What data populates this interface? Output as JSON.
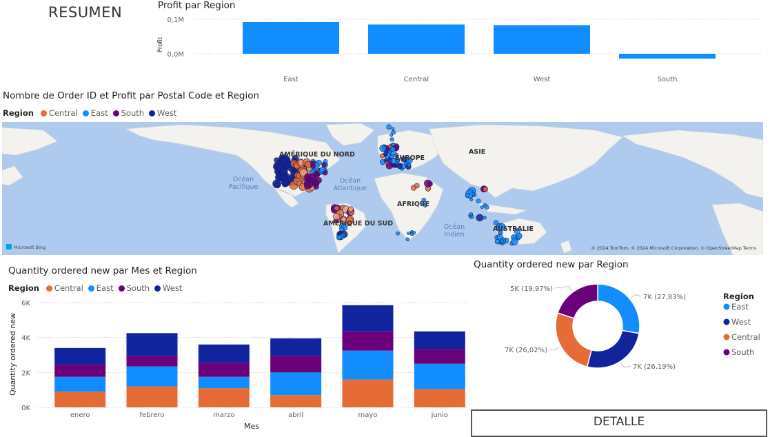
{
  "header": {
    "title": "RESUMEN"
  },
  "colors": {
    "central": "#E66C37",
    "east": "#118DFF",
    "south": "#6B007B",
    "west": "#12239E",
    "ocean": "#A7C7EC",
    "land": "#F2F1EC"
  },
  "profit_chart": {
    "title": "Profit par Region",
    "ylabel": "Profit",
    "yticks": [
      "0,1M",
      "0,0M"
    ],
    "chart_data": {
      "type": "bar",
      "categories": [
        "East",
        "Central",
        "West",
        "South"
      ],
      "values": [
        0.092,
        0.085,
        0.083,
        -0.014
      ],
      "ylim": [
        -0.02,
        0.12
      ],
      "unit": "M"
    }
  },
  "map": {
    "title": "Nombre de Order ID et Profit par Postal Code et Region",
    "legend_title": "Region",
    "legend": [
      "Central",
      "East",
      "South",
      "West"
    ],
    "labels": {
      "north_america": "AMÉRIQUE DU NORD",
      "south_america": "AMÉRIQUE DU SUD",
      "europe": "EUROPE",
      "asia": "ASIE",
      "africa": "AFRIQUE",
      "australia": "AUSTRALIE",
      "pacific": "Océan\nPacifique",
      "atlantic": "Océan\nAtlantique",
      "indian": "Océan\nIndien"
    },
    "bing": "Microsoft Bing",
    "copyright": "© 2024 TomTom, © 2024 Microsoft Corporation, © OpenStreetMap  Terms"
  },
  "stacked_chart": {
    "title": "Quantity ordered new par Mes et Region",
    "legend_title": "Region",
    "xlabel": "Mes",
    "ylabel": "Quantity ordered new",
    "ytick_labels": [
      "0K",
      "2K",
      "4K",
      "6K"
    ],
    "chart_data": {
      "type": "bar",
      "stacked": true,
      "categories": [
        "enero",
        "febrero",
        "marzo",
        "abril",
        "mayo",
        "junio"
      ],
      "ylim": [
        0,
        6000
      ],
      "series": [
        {
          "name": "Central",
          "values": [
            900,
            1200,
            1100,
            700,
            1600,
            1050
          ]
        },
        {
          "name": "East",
          "values": [
            850,
            1150,
            650,
            1300,
            1650,
            1450
          ]
        },
        {
          "name": "South",
          "values": [
            700,
            600,
            800,
            950,
            1100,
            850
          ]
        },
        {
          "name": "West",
          "values": [
            950,
            1300,
            1050,
            1000,
            1500,
            1000
          ]
        }
      ]
    }
  },
  "donut_chart": {
    "title": "Quantity ordered new par Region",
    "legend_title": "Region",
    "chart_data": {
      "type": "pie",
      "donut": true,
      "slices": [
        {
          "name": "East",
          "label": "7K (27,83%)",
          "percent": 27.83
        },
        {
          "name": "West",
          "label": "7K (26,19%)",
          "percent": 26.19
        },
        {
          "name": "Central",
          "label": "7K (26,02%)",
          "percent": 26.02
        },
        {
          "name": "South",
          "label": "5K (19,97%)",
          "percent": 19.97
        }
      ]
    }
  },
  "detalle": {
    "label": "DETALLE"
  }
}
